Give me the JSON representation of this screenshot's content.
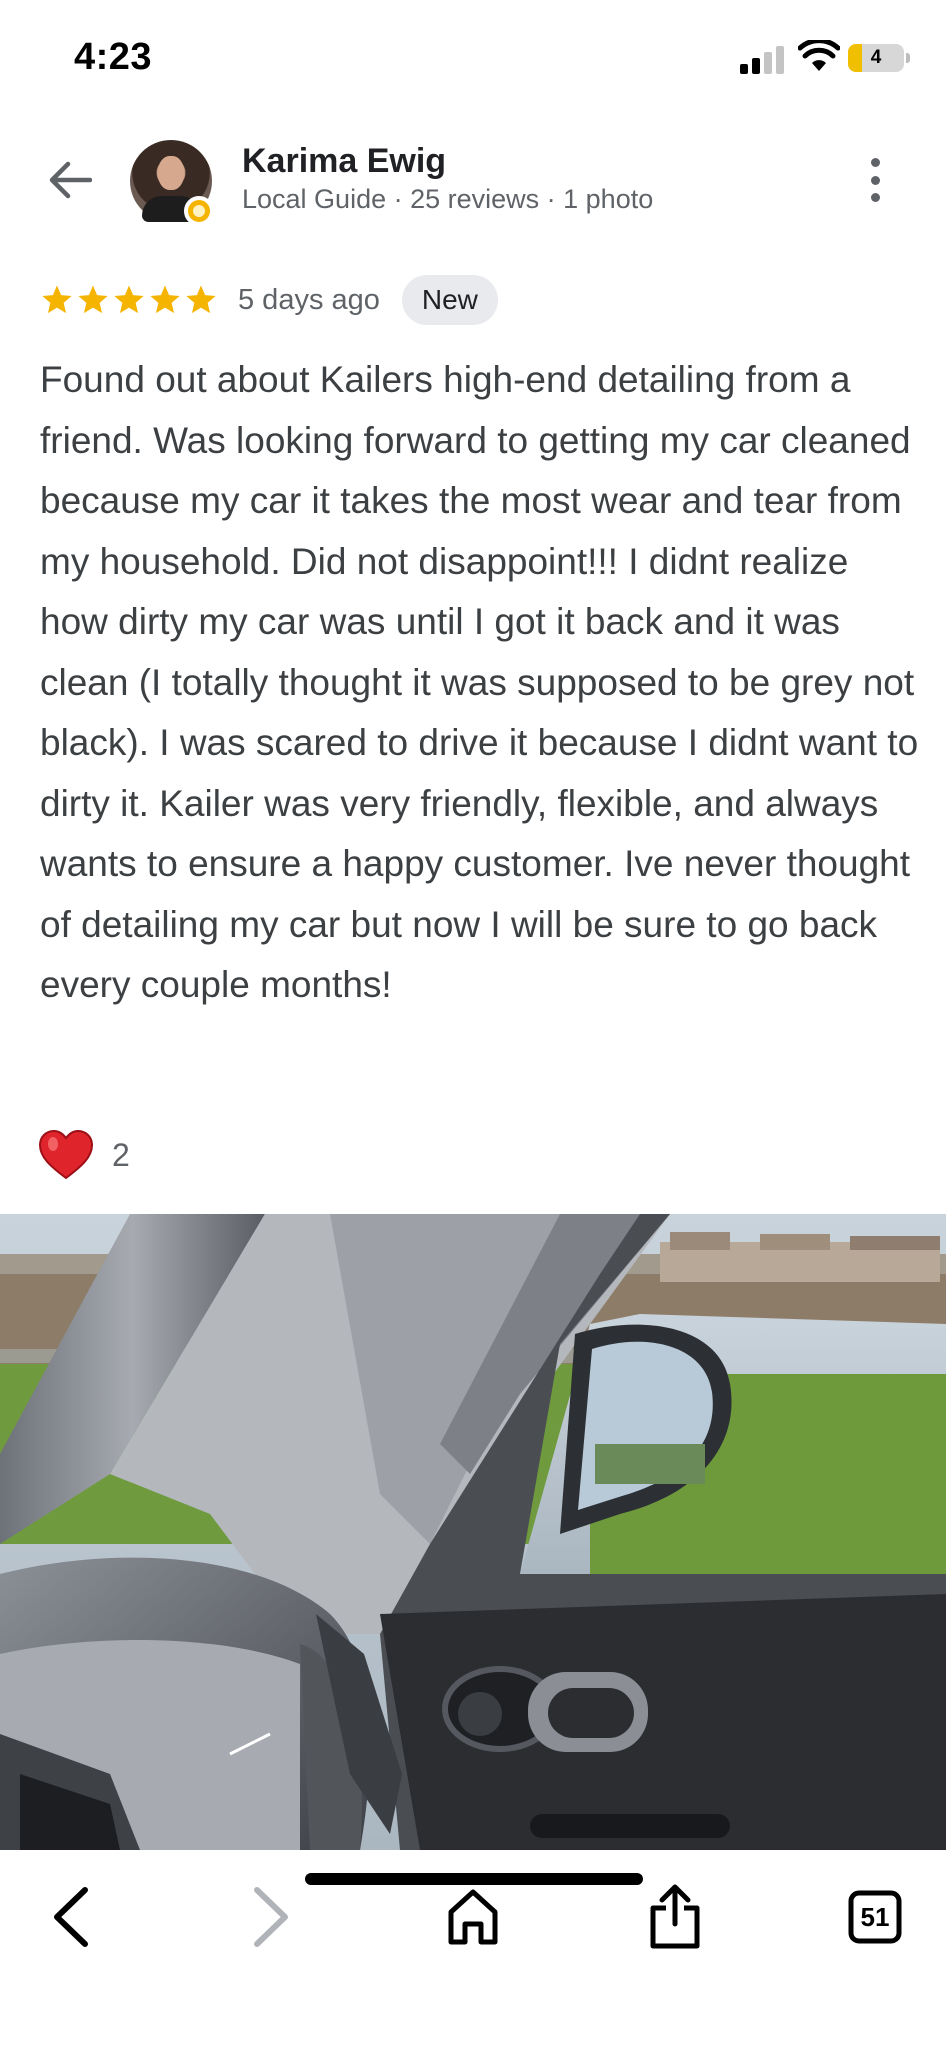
{
  "status_bar": {
    "time": "4:23",
    "battery_level": "4",
    "signal_bars_active": 2,
    "signal_bars_total": 4
  },
  "header": {
    "user_name": "Karima Ewig",
    "user_meta": "Local Guide · 25 reviews · 1 photo",
    "back_icon": "arrow-left-icon",
    "more_icon": "more-vert-icon"
  },
  "review": {
    "rating": 5,
    "max_rating": 5,
    "date": "5 days ago",
    "badge": "New",
    "text": "Found out about Kailers high-end detailing from a friend. Was looking forward to getting my car cleaned because my car it takes the most wear and tear from my household. Did not disappoint!!! I didnt realize how dirty my car was until I got it back and it was clean (I totally thought it was supposed to be grey not black). I was scared to drive it because I didnt want to dirty it. Kailer was very friendly, flexible, and always wants to ensure a happy customer. Ive never thought of detailing my car but now I will be sure to go back every couple months!",
    "reaction_icon": "heart-icon",
    "reaction_count": "2"
  },
  "toolbar": {
    "back_icon": "chevron-left-icon",
    "forward_icon": "chevron-right-icon",
    "home_icon": "home-icon",
    "share_icon": "share-icon",
    "tabs_count": "51"
  },
  "colors": {
    "star": "#f4b400",
    "text": "#3c4043",
    "meta": "#5f6368",
    "badge_bg": "#e8eaed",
    "heart": "#e0242c",
    "forward_disabled": "#b0b3b8"
  }
}
